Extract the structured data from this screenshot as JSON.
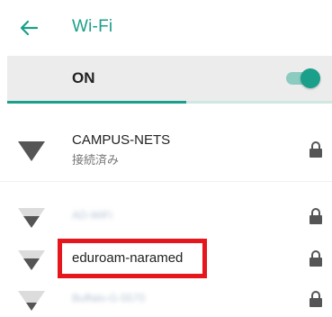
{
  "header": {
    "title": "Wi-Fi",
    "back_icon": "arrow-left-icon"
  },
  "toggle": {
    "label": "ON",
    "state": true
  },
  "scan_progress": 0.55,
  "colors": {
    "accent": "#1a9f8a",
    "highlight": "#e5161c"
  },
  "networks": [
    {
      "ssid": "CAMPUS-NETS",
      "status": "接続済み",
      "secured": true,
      "signal": 4,
      "blurred": false
    },
    {
      "ssid": "AD-WiFi",
      "status": "",
      "secured": true,
      "signal": 3,
      "blurred": true
    },
    {
      "ssid": "eduroam-naramed",
      "status": "",
      "secured": true,
      "signal": 3,
      "blurred": false,
      "highlighted": true
    },
    {
      "ssid": "Buffalo-G-5570",
      "status": "",
      "secured": true,
      "signal": 2,
      "blurred": true
    }
  ]
}
